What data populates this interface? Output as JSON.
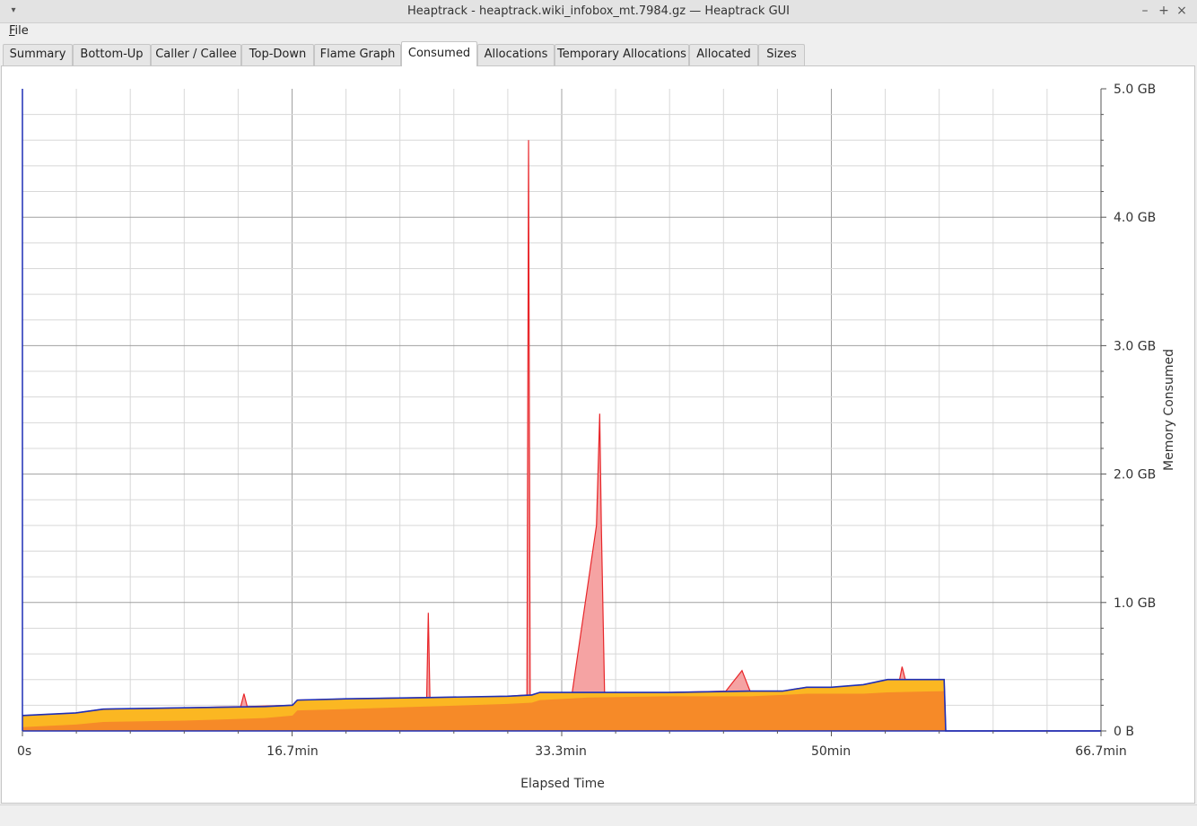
{
  "window": {
    "title": "Heaptrack - heaptrack.wiki_infobox_mt.7984.gz — Heaptrack GUI",
    "minimize_glyph": "–",
    "maximize_glyph": "+",
    "close_glyph": "×",
    "menu_glyph": "▾"
  },
  "menubar": {
    "file_mnemonic": "F",
    "file_rest": "ile"
  },
  "tabs": [
    {
      "label": "Summary"
    },
    {
      "label": "Bottom-Up"
    },
    {
      "label": "Caller / Callee"
    },
    {
      "label": "Top-Down"
    },
    {
      "label": "Flame Graph"
    },
    {
      "label": "Consumed",
      "active": true
    },
    {
      "label": "Allocations"
    },
    {
      "label": "Temporary Allocations"
    },
    {
      "label": "Allocated"
    },
    {
      "label": "Sizes"
    }
  ],
  "chart_data": {
    "type": "area",
    "xlabel": "Elapsed Time",
    "ylabel": "Memory Consumed",
    "xlim": [
      0,
      66.7
    ],
    "ylim": [
      0,
      5.0
    ],
    "x_unit": "min",
    "y_unit": "GB",
    "x_ticks": [
      {
        "value": 0,
        "label": "0s"
      },
      {
        "value": 16.7,
        "label": "16.7min"
      },
      {
        "value": 33.3,
        "label": "33.3min"
      },
      {
        "value": 50,
        "label": "50min"
      },
      {
        "value": 66.7,
        "label": "66.7min"
      }
    ],
    "y_ticks": [
      {
        "value": 0,
        "label": "0 B"
      },
      {
        "value": 1,
        "label": "1.0 GB"
      },
      {
        "value": 2,
        "label": "2.0 GB"
      },
      {
        "value": 3,
        "label": "3.0 GB"
      },
      {
        "value": 4,
        "label": "4.0 GB"
      },
      {
        "value": 5,
        "label": "5.0 GB"
      }
    ],
    "grid": true,
    "colors": {
      "bottom_layer": "#f68a28",
      "mid_layer": "#fbb722",
      "spike_line": "#e8262a",
      "spike_fill": "#f5a3a3",
      "total_line": "#1f2fb6",
      "grid_major": "#a0a0a0",
      "grid_minor": "#d8d8d8"
    },
    "series": [
      {
        "x": [
          0,
          3.3,
          5,
          10,
          15,
          16.7,
          17,
          20,
          25,
          30,
          31.5,
          32,
          35,
          40,
          45,
          47,
          48.5,
          50,
          52,
          53.5,
          57,
          57.1,
          66.7
        ],
        "values": [
          0.03,
          0.05,
          0.07,
          0.08,
          0.1,
          0.12,
          0.16,
          0.17,
          0.19,
          0.21,
          0.22,
          0.24,
          0.26,
          0.27,
          0.27,
          0.28,
          0.29,
          0.29,
          0.29,
          0.3,
          0.31,
          0,
          0
        ]
      },
      {
        "x": [
          0,
          3.3,
          5,
          10,
          15,
          16.7,
          17,
          20,
          25,
          30,
          31.5,
          32,
          35,
          40,
          45,
          47,
          48.5,
          50,
          52,
          53.5,
          57,
          57.1,
          66.7
        ],
        "values": [
          0.12,
          0.14,
          0.17,
          0.18,
          0.19,
          0.2,
          0.24,
          0.25,
          0.26,
          0.27,
          0.28,
          0.3,
          0.3,
          0.3,
          0.31,
          0.31,
          0.34,
          0.34,
          0.36,
          0.4,
          0.4,
          0,
          0
        ]
      },
      {
        "x": [
          0,
          3.3,
          5,
          10,
          13.5,
          13.7,
          13.9,
          16.7,
          17,
          20,
          25,
          25.1,
          25.2,
          25.3,
          25.4,
          30,
          31.2,
          31.3,
          31.4,
          31.5,
          32,
          34,
          35.5,
          35.7,
          35.8,
          36,
          36.2,
          40,
          43.5,
          44.5,
          45,
          47,
          48.5,
          50,
          54.2,
          54.4,
          54.6,
          57,
          57.1,
          66.7
        ],
        "values": [
          0.12,
          0.14,
          0.17,
          0.18,
          0.19,
          0.29,
          0.19,
          0.2,
          0.24,
          0.25,
          0.26,
          0.92,
          0.26,
          0.26,
          0.26,
          0.27,
          0.28,
          4.6,
          0.28,
          0.28,
          0.3,
          0.3,
          1.6,
          2.47,
          1.6,
          0.3,
          0.3,
          0.3,
          0.31,
          0.47,
          0.31,
          0.31,
          0.34,
          0.34,
          0.37,
          0.5,
          0.4,
          0.4,
          0,
          0
        ]
      }
    ]
  }
}
